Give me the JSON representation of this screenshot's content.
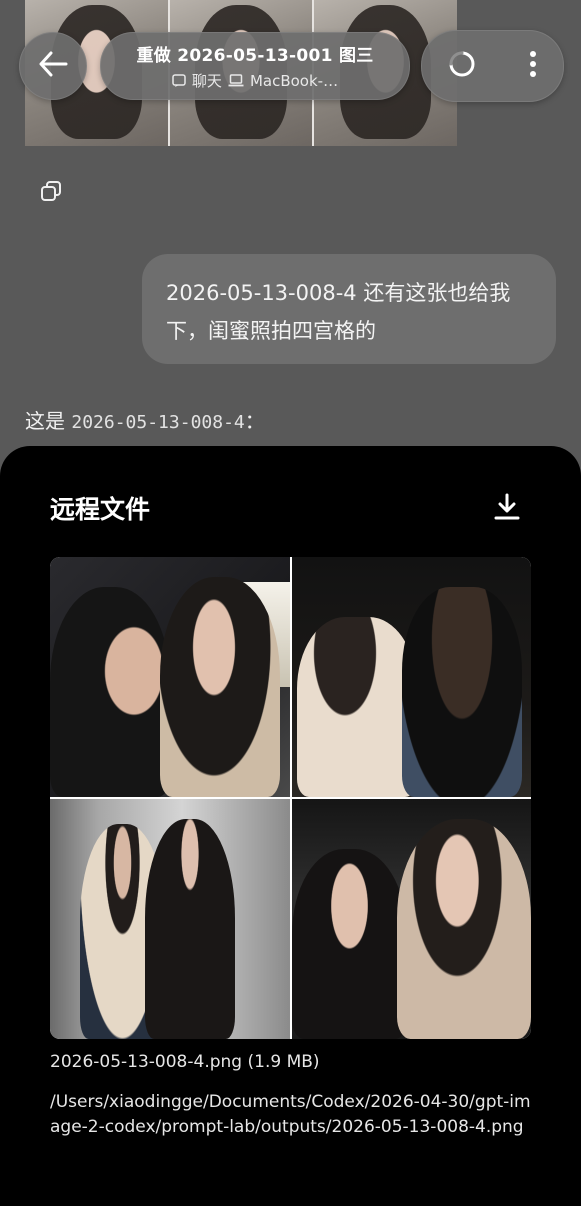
{
  "header": {
    "title": "重做 2026-05-13-001 图三",
    "subtitle_chat": "聊天",
    "subtitle_device": "MacBook-…"
  },
  "icons": {
    "back": "arrow-left-icon",
    "loading": "spinner-icon",
    "more": "more-vertical-icon",
    "copy": "copy-icon",
    "chat": "chat-icon",
    "laptop": "laptop-icon",
    "download": "download-icon"
  },
  "conversation": {
    "user_message": "2026-05-13-008-4 还有这张也给我下，闺蜜照拍四宫格的",
    "reply_prefix": "这是",
    "reply_code": "2026-05-13-008-4",
    "reply_suffix": "："
  },
  "sheet": {
    "title": "远程文件",
    "file_name": "2026-05-13-008-4.png (1.9 MB)",
    "file_path": "/Users/xiaodingge/Documents/Codex/2026-04-30/gpt-image-2-codex/prompt-lab/outputs/2026-05-13-008-4.png"
  },
  "colors": {
    "background": "#595959",
    "bubble": "#6e6e6e",
    "sheet": "#000000"
  }
}
